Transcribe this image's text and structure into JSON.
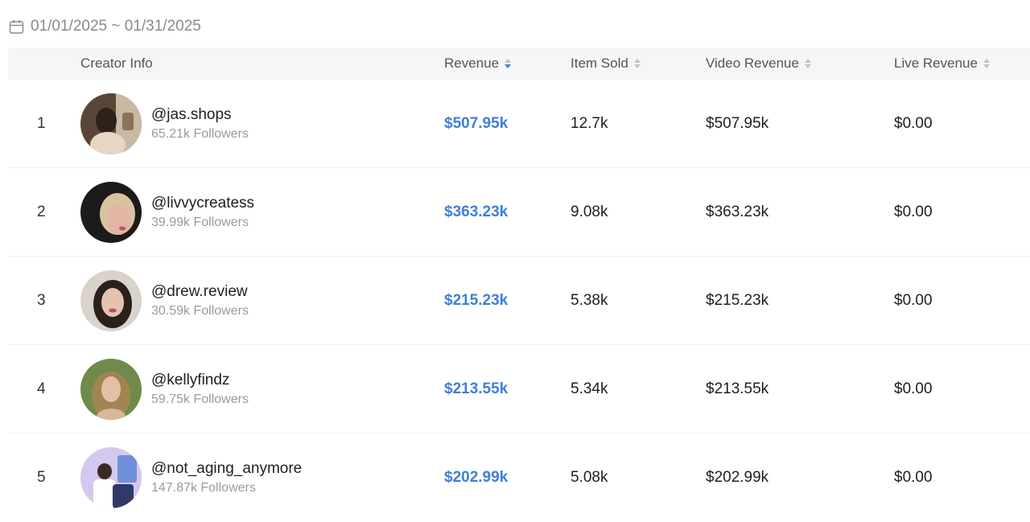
{
  "date_range": "01/01/2025 ~ 01/31/2025",
  "columns": {
    "creator_info": "Creator Info",
    "revenue": "Revenue",
    "item_sold": "Item Sold",
    "video_revenue": "Video Revenue",
    "live_revenue": "Live Revenue"
  },
  "sort": {
    "column": "revenue",
    "direction": "descending"
  },
  "rows": [
    {
      "rank": "1",
      "handle": "@jas.shops",
      "followers": "65.21k Followers",
      "revenue": "$507.95k",
      "item_sold": "12.7k",
      "video_revenue": "$507.95k",
      "live_revenue": "$0.00"
    },
    {
      "rank": "2",
      "handle": "@livvycreatess",
      "followers": "39.99k Followers",
      "revenue": "$363.23k",
      "item_sold": "9.08k",
      "video_revenue": "$363.23k",
      "live_revenue": "$0.00"
    },
    {
      "rank": "3",
      "handle": "@drew.review",
      "followers": "30.59k Followers",
      "revenue": "$215.23k",
      "item_sold": "5.38k",
      "video_revenue": "$215.23k",
      "live_revenue": "$0.00"
    },
    {
      "rank": "4",
      "handle": "@kellyfindz",
      "followers": "59.75k Followers",
      "revenue": "$213.55k",
      "item_sold": "5.34k",
      "video_revenue": "$213.55k",
      "live_revenue": "$0.00"
    },
    {
      "rank": "5",
      "handle": "@not_aging_anymore",
      "followers": "147.87k Followers",
      "revenue": "$202.99k",
      "item_sold": "5.08k",
      "video_revenue": "$202.99k",
      "live_revenue": "$0.00"
    }
  ],
  "colors": {
    "accent": "#3f7fd6",
    "header_bg": "#f5f6f7",
    "muted_text": "#9a9a9a"
  }
}
